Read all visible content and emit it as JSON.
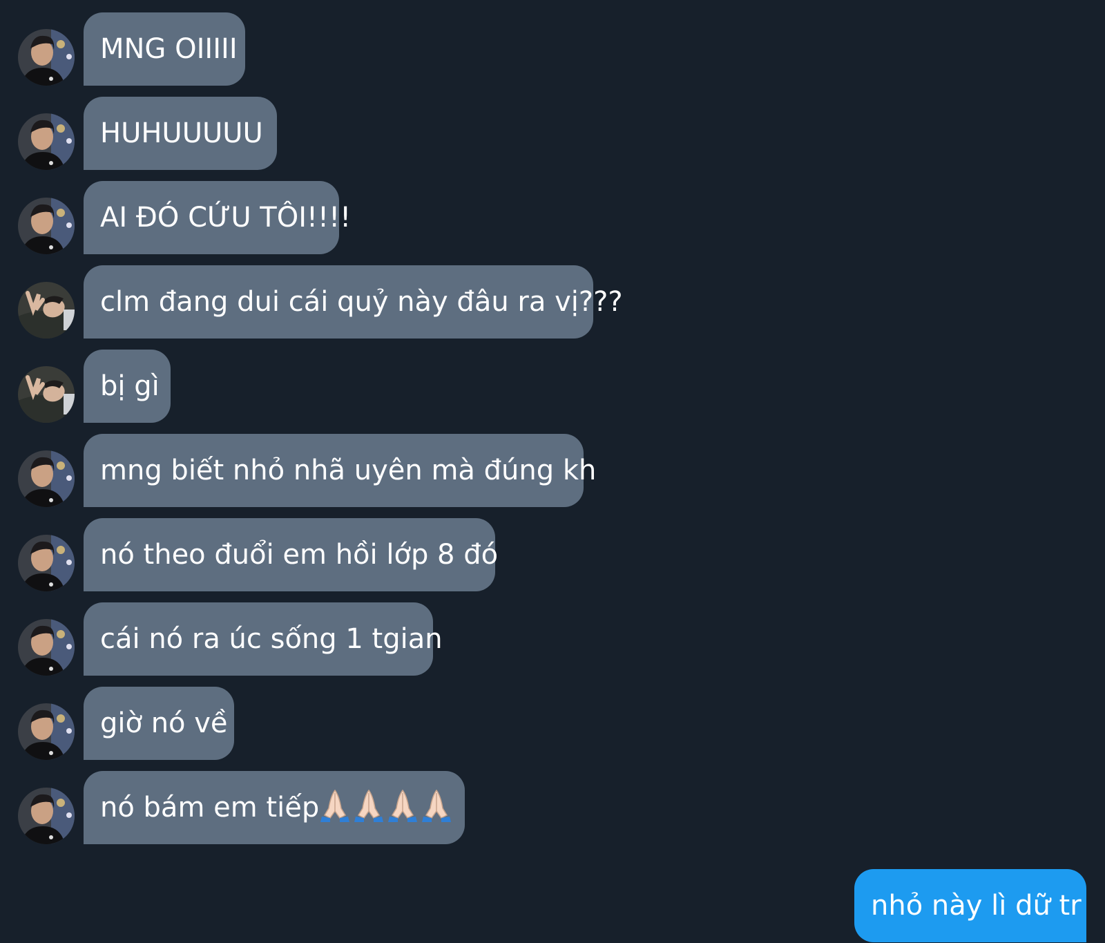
{
  "conversation": {
    "messages": [
      {
        "sender": "other",
        "avatar": "male-avatar-dark-jacket",
        "text": "MNG OIIIII"
      },
      {
        "sender": "other",
        "avatar": "male-avatar-dark-jacket",
        "text": "HUHUUUUU"
      },
      {
        "sender": "other",
        "avatar": "male-avatar-dark-jacket",
        "text": "AI ĐÓ CỨU TÔI!!!!"
      },
      {
        "sender": "other",
        "avatar": "male-avatar-lying-down",
        "text": "clm đang dui cái quỷ này đâu ra vị???"
      },
      {
        "sender": "other",
        "avatar": "male-avatar-lying-down",
        "text": "bị gì"
      },
      {
        "sender": "other",
        "avatar": "male-avatar-dark-jacket",
        "text": "mng biết nhỏ nhã uyên mà đúng kh"
      },
      {
        "sender": "other",
        "avatar": "male-avatar-dark-jacket",
        "text": "nó theo đuổi em hồi lớp 8 đó"
      },
      {
        "sender": "other",
        "avatar": "male-avatar-dark-jacket",
        "text": "cái nó ra úc sống 1 tgian"
      },
      {
        "sender": "other",
        "avatar": "male-avatar-dark-jacket",
        "text": "giờ nó về"
      },
      {
        "sender": "other",
        "avatar": "male-avatar-dark-jacket",
        "text": "nó bám em tiếp",
        "emoji": [
          "folded-hands-icon",
          "folded-hands-icon",
          "folded-hands-icon",
          "folded-hands-icon"
        ]
      },
      {
        "sender": "me",
        "text": "nhỏ này lì dữ tr"
      }
    ]
  },
  "colors": {
    "background": "#17202b",
    "incoming_bubble": "#5e6e80",
    "outgoing_bubble": "#1d9bf0",
    "text": "#ffffff"
  }
}
